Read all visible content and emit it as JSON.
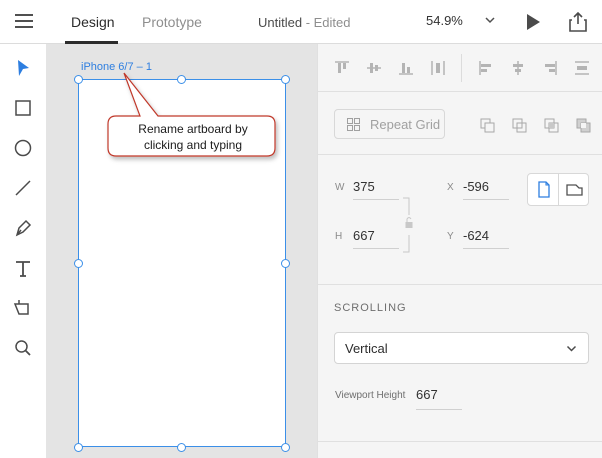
{
  "topbar": {
    "tabs": [
      {
        "label": "Design",
        "active": true
      },
      {
        "label": "Prototype",
        "active": false
      }
    ],
    "doc_name": "Untitled",
    "doc_status": " - Edited",
    "zoom": "54.9%"
  },
  "toolbar": {
    "tools": [
      "select-tool",
      "rectangle-tool",
      "ellipse-tool",
      "line-tool",
      "pen-tool",
      "text-tool",
      "artboard-tool",
      "zoom-tool"
    ]
  },
  "canvas": {
    "artboard_name": "iPhone 6/7 – 1",
    "callout_line1": "Rename artboard by",
    "callout_line2": "clicking and typing"
  },
  "panel": {
    "repeat_grid_label": "Repeat Grid",
    "geometry": {
      "w_label": "W",
      "w_value": "375",
      "h_label": "H",
      "h_value": "667",
      "x_label": "X",
      "x_value": "-596",
      "y_label": "Y",
      "y_value": "-624"
    },
    "scrolling": {
      "heading": "SCROLLING",
      "selected": "Vertical",
      "viewport_label": "Viewport Height",
      "viewport_value": "667"
    }
  },
  "colors": {
    "accent": "#2d7ee0",
    "selection": "#3b8fe8",
    "callout_border": "#c0392b",
    "canvas_bg": "#e4e4e4",
    "panel_bg": "#f5f5f5"
  }
}
